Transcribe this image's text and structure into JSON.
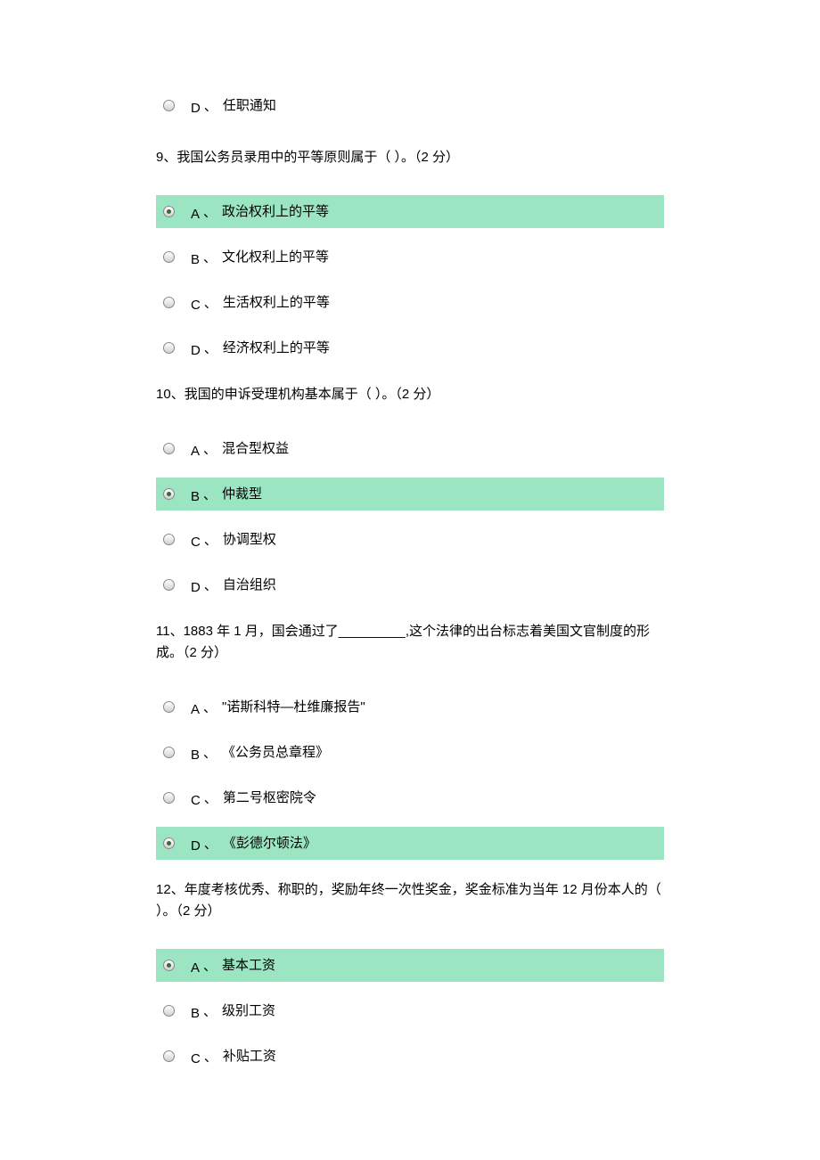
{
  "orphan_option": {
    "letter": "D",
    "sep": "、",
    "text": "任职通知"
  },
  "questions": [
    {
      "number": "9",
      "sep": "、",
      "text": "我国公务员录用中的平等原则属于（ ）。（2 分）",
      "options": [
        {
          "letter": "A",
          "sep": "、",
          "text": "政治权利上的平等",
          "selected": true
        },
        {
          "letter": "B",
          "sep": "、",
          "text": "文化权利上的平等",
          "selected": false
        },
        {
          "letter": "C",
          "sep": "、",
          "text": "生活权利上的平等",
          "selected": false
        },
        {
          "letter": "D",
          "sep": "、",
          "text": "经济权利上的平等",
          "selected": false
        }
      ]
    },
    {
      "number": "10",
      "sep": "、",
      "text": "我国的申诉受理机构基本属于（ ）。（2 分）",
      "options": [
        {
          "letter": "A",
          "sep": "、",
          "text": "混合型权益",
          "selected": false
        },
        {
          "letter": "B",
          "sep": "、",
          "text": "仲裁型",
          "selected": true
        },
        {
          "letter": "C",
          "sep": "、",
          "text": "协调型权",
          "selected": false
        },
        {
          "letter": "D",
          "sep": "、",
          "text": "自治组织",
          "selected": false
        }
      ]
    },
    {
      "number": "11",
      "sep": "、",
      "text": "1883 年 1 月，国会通过了_________,这个法律的出台标志着美国文官制度的形成。（2 分）",
      "options": [
        {
          "letter": "A",
          "sep": "、",
          "text": "\"诺斯科特—杜维廉报告\"",
          "selected": false
        },
        {
          "letter": "B",
          "sep": "、",
          "text": "《公务员总章程》",
          "selected": false
        },
        {
          "letter": "C",
          "sep": "、",
          "text": "第二号枢密院令",
          "selected": false
        },
        {
          "letter": "D",
          "sep": "、",
          "text": "《彭德尔顿法》",
          "selected": true
        }
      ]
    },
    {
      "number": "12",
      "sep": "、",
      "text": "年度考核优秀、称职的，奖励年终一次性奖金，奖金标准为当年 12 月份本人的（ ）。（2 分）",
      "options": [
        {
          "letter": "A",
          "sep": "、",
          "text": "基本工资",
          "selected": true
        },
        {
          "letter": "B",
          "sep": "、",
          "text": "级别工资",
          "selected": false
        },
        {
          "letter": "C",
          "sep": "、",
          "text": "补贴工资",
          "selected": false
        }
      ]
    }
  ]
}
